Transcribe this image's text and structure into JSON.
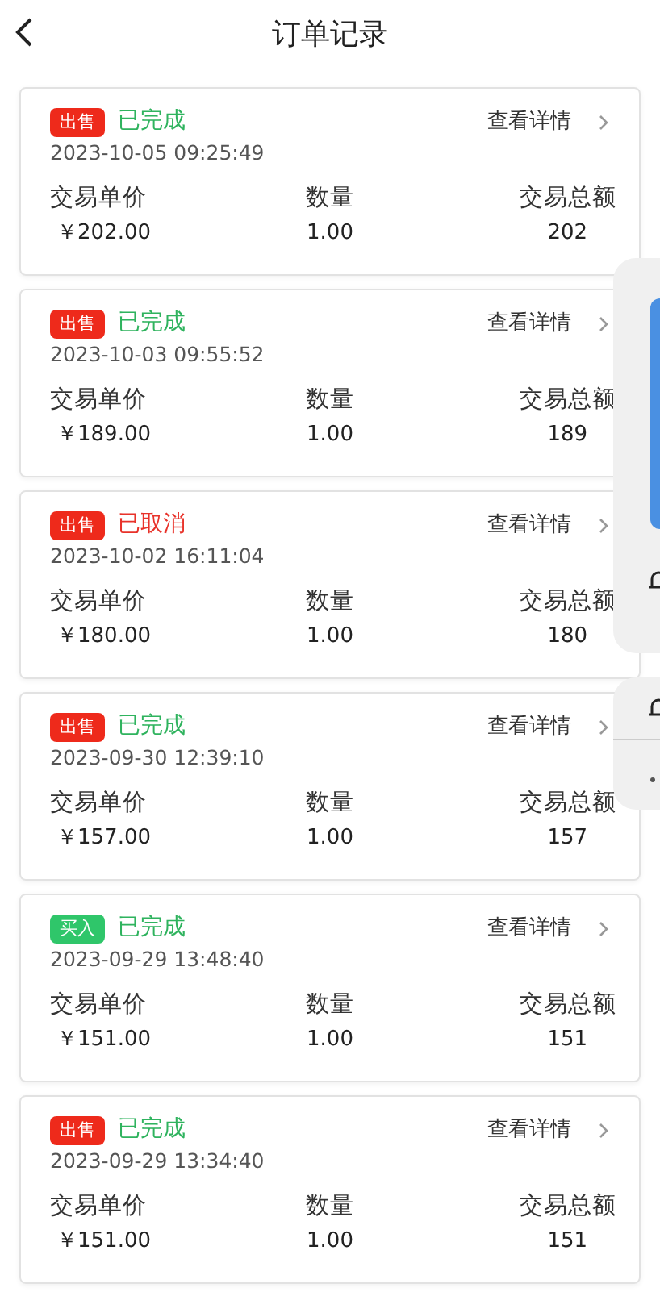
{
  "header": {
    "title": "订单记录"
  },
  "orders": [
    {
      "kind": "sell",
      "side_label": "出售",
      "color": "#2fb35e",
      "status": "已完成",
      "time": "2023-10-05 09:25:49",
      "details": "查看详情",
      "labels": [
        "交易单价",
        "数量",
        "交易总额"
      ],
      "values": [
        "￥202.00",
        "1.00",
        "202"
      ]
    },
    {
      "kind": "sell",
      "side_label": "出售",
      "color": "#2fb35e",
      "status": "已完成",
      "time": "2023-10-03 09:55:52",
      "details": "查看详情",
      "labels": [
        "交易单价",
        "数量",
        "交易总额"
      ],
      "values": [
        "￥189.00",
        "1.00",
        "189"
      ]
    },
    {
      "kind": "sell",
      "side_label": "出售",
      "color": "#e8322a",
      "status": "已取消",
      "time": "2023-10-02 16:11:04",
      "details": "查看详情",
      "labels": [
        "交易单价",
        "数量",
        "交易总额"
      ],
      "values": [
        "￥180.00",
        "1.00",
        "180"
      ]
    },
    {
      "kind": "sell",
      "side_label": "出售",
      "color": "#2fb35e",
      "status": "已完成",
      "time": "2023-09-30 12:39:10",
      "details": "查看详情",
      "labels": [
        "交易单价",
        "数量",
        "交易总额"
      ],
      "values": [
        "￥157.00",
        "1.00",
        "157"
      ]
    },
    {
      "kind": "buy",
      "side_label": "买入",
      "color": "#2fb35e",
      "status": "已完成",
      "time": "2023-09-29 13:48:40",
      "details": "查看详情",
      "labels": [
        "交易单价",
        "数量",
        "交易总额"
      ],
      "values": [
        "￥151.00",
        "1.00",
        "151"
      ]
    },
    {
      "kind": "sell",
      "side_label": "出售",
      "color": "#2fb35e",
      "status": "已完成",
      "time": "2023-09-29 13:34:40",
      "details": "查看详情",
      "labels": [
        "交易单价",
        "数量",
        "交易总额"
      ],
      "values": [
        "￥151.00",
        "1.00",
        "151"
      ]
    }
  ]
}
